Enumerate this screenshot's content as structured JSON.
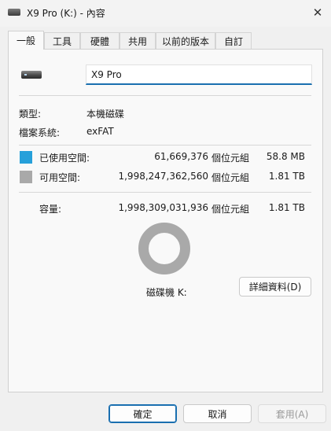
{
  "window": {
    "title": "X9 Pro (K:) - 內容",
    "close_glyph": "✕"
  },
  "tabs": [
    {
      "label": "一般",
      "active": true
    },
    {
      "label": "工具"
    },
    {
      "label": "硬體"
    },
    {
      "label": "共用"
    },
    {
      "label": "以前的版本"
    },
    {
      "label": "自訂"
    }
  ],
  "general": {
    "drive_name": "X9 Pro",
    "type_label": "類型:",
    "type_value": "本機磁碟",
    "fs_label": "檔案系統:",
    "fs_value": "exFAT",
    "used": {
      "label": "已使用空間:",
      "bytes": "61,669,376",
      "unit": "個位元組",
      "size": "58.8 MB",
      "color": "#26a0da"
    },
    "free": {
      "label": "可用空間:",
      "bytes": "1,998,247,362,560",
      "unit": "個位元組",
      "size": "1.81 TB",
      "color": "#a9a9a9"
    },
    "capacity": {
      "label": "容量:",
      "bytes": "1,998,309,031,936",
      "unit": "個位元組",
      "size": "1.81 TB"
    },
    "drive_label": "磁碟機 K:",
    "details_button": "詳細資料(D)"
  },
  "footer": {
    "ok": "確定",
    "cancel": "取消",
    "apply": "套用(A)"
  }
}
